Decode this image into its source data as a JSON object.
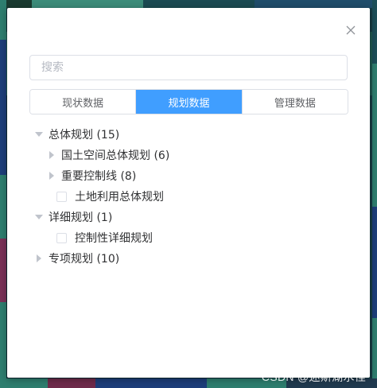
{
  "search": {
    "placeholder": "搜索"
  },
  "tabs": [
    {
      "label": "现状数据",
      "active": false
    },
    {
      "label": "规划数据",
      "active": true
    },
    {
      "label": "管理数据",
      "active": false
    }
  ],
  "tree": {
    "n0": {
      "label": "总体规划 (15)",
      "expanded": true
    },
    "n0_c0": {
      "label": "国土空间总体规划 (6)",
      "expanded": false
    },
    "n0_c1": {
      "label": "重要控制线 (8)",
      "expanded": false
    },
    "n0_c2": {
      "label": "土地利用总体规划",
      "checked": false
    },
    "n1": {
      "label": "详细规划 (1)",
      "expanded": true
    },
    "n1_c0": {
      "label": "控制性详细规划",
      "checked": false
    },
    "n2": {
      "label": "专项规划 (10)",
      "expanded": false
    }
  },
  "watermark": "CSDN @迷斯湖水怪",
  "colors": {
    "accent": "#409eff",
    "text": "#303133",
    "border": "#dcdfe6"
  }
}
